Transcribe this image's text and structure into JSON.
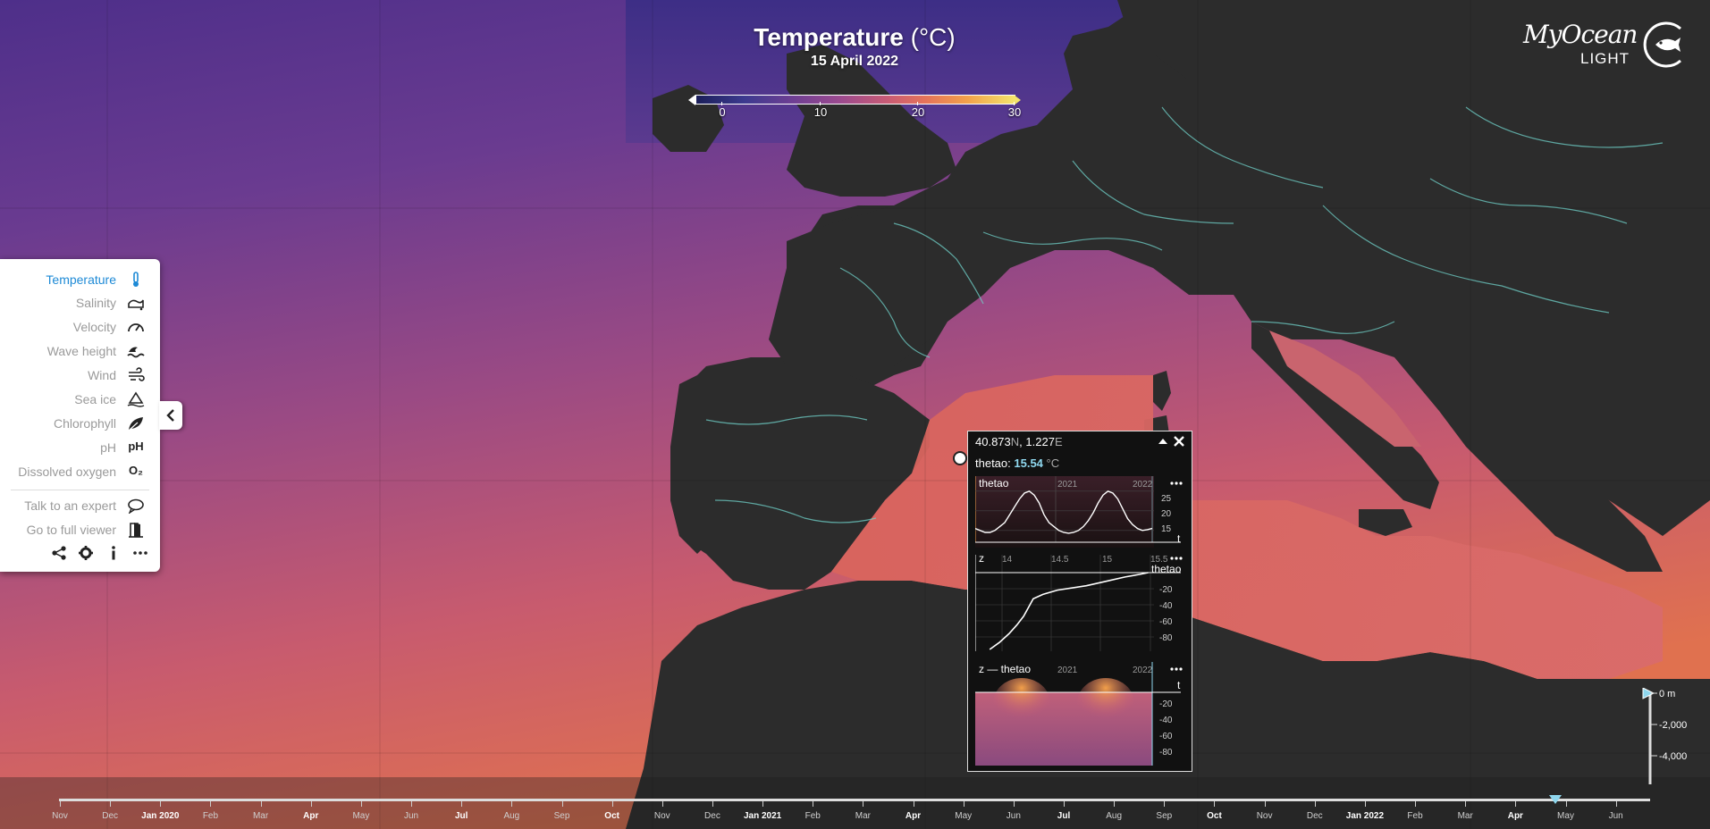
{
  "header": {
    "title": "Temperature",
    "unit": "(°C)",
    "date": "15 April 2022"
  },
  "colorbar": {
    "ticks": [
      "0",
      "10",
      "20",
      "30"
    ],
    "colors": [
      "#1b1f5a",
      "#6d3f93",
      "#c85b75",
      "#f2a04a",
      "#f3e46b"
    ]
  },
  "logo": {
    "name": "MyOcean",
    "sub": "LIGHT"
  },
  "sidebar": {
    "items": [
      {
        "label": "Temperature",
        "icon": "thermometer-icon",
        "active": true
      },
      {
        "label": "Salinity",
        "icon": "salinity-icon"
      },
      {
        "label": "Velocity",
        "icon": "speedometer-icon"
      },
      {
        "label": "Wave height",
        "icon": "wave-icon"
      },
      {
        "label": "Wind",
        "icon": "wind-icon"
      },
      {
        "label": "Sea ice",
        "icon": "sea-ice-icon"
      },
      {
        "label": "Chlorophyll",
        "icon": "leaf-icon"
      },
      {
        "label": "pH",
        "icon": "ph-icon",
        "icon_text": "pH"
      },
      {
        "label": "Dissolved oxygen",
        "icon": "oxygen-icon",
        "icon_text": "O₂"
      }
    ],
    "extra": [
      {
        "label": "Talk to an expert",
        "icon": "chat-icon"
      },
      {
        "label": "Go to full viewer",
        "icon": "door-icon"
      }
    ],
    "tools": [
      "share-icon",
      "gear-icon",
      "info-icon",
      "more-icon"
    ]
  },
  "popup": {
    "coords_lat": "40.873",
    "coords_lat_dir": "N",
    "coords_sep": ", ",
    "coords_lon": "1.227",
    "coords_lon_dir": "E",
    "var_label": "thetao: ",
    "var_value": "15.54",
    "var_unit": " °C",
    "panel1": {
      "label": "thetao",
      "years": [
        "2021",
        "2022"
      ],
      "yticks": [
        "25",
        "20",
        "15"
      ],
      "axis": "t",
      "series": [
        15.5,
        15,
        14.5,
        14.5,
        15,
        16,
        17,
        19,
        21,
        23,
        24.5,
        25,
        24,
        22,
        19,
        17,
        16,
        15,
        14.5,
        14.3,
        14.5,
        15,
        16,
        17.5,
        19.5,
        22,
        24,
        25,
        24.5,
        23,
        20.5,
        18,
        16.5,
        15.5,
        15,
        15.2,
        15.5
      ]
    },
    "panel2": {
      "label": "z",
      "var": "thetao",
      "xticks": [
        "14",
        "14.5",
        "15",
        "15.5"
      ],
      "yticks": [
        "-20",
        "-40",
        "-60",
        "-80"
      ],
      "profile": [
        [
          15.54,
          0
        ],
        [
          15.45,
          -2
        ],
        [
          15.3,
          -5
        ],
        [
          15.1,
          -10
        ],
        [
          14.9,
          -15
        ],
        [
          14.6,
          -20
        ],
        [
          14.45,
          -25
        ],
        [
          14.35,
          -30
        ],
        [
          14.3,
          -40
        ],
        [
          14.25,
          -50
        ],
        [
          14.18,
          -60
        ],
        [
          14.1,
          -70
        ],
        [
          14.0,
          -80
        ],
        [
          13.9,
          -88
        ]
      ]
    },
    "panel3": {
      "label": "z — thetao",
      "years": [
        "2021",
        "2022"
      ],
      "axis": "t",
      "yticks": [
        "-20",
        "-40",
        "-60",
        "-80"
      ]
    }
  },
  "depth": {
    "labels": [
      "0 m",
      "-2,000",
      "-4,000"
    ]
  },
  "timeline": {
    "labels": [
      {
        "text": "Nov",
        "strong": false
      },
      {
        "text": "Dec",
        "strong": false
      },
      {
        "text": "Jan 2020",
        "strong": true
      },
      {
        "text": "Feb",
        "strong": false
      },
      {
        "text": "Mar",
        "strong": false
      },
      {
        "text": "Apr",
        "strong": true
      },
      {
        "text": "May",
        "strong": false
      },
      {
        "text": "Jun",
        "strong": false
      },
      {
        "text": "Jul",
        "strong": true
      },
      {
        "text": "Aug",
        "strong": false
      },
      {
        "text": "Sep",
        "strong": false
      },
      {
        "text": "Oct",
        "strong": true
      },
      {
        "text": "Nov",
        "strong": false
      },
      {
        "text": "Dec",
        "strong": false
      },
      {
        "text": "Jan 2021",
        "strong": true
      },
      {
        "text": "Feb",
        "strong": false
      },
      {
        "text": "Mar",
        "strong": false
      },
      {
        "text": "Apr",
        "strong": true
      },
      {
        "text": "May",
        "strong": false
      },
      {
        "text": "Jun",
        "strong": false
      },
      {
        "text": "Jul",
        "strong": true
      },
      {
        "text": "Aug",
        "strong": false
      },
      {
        "text": "Sep",
        "strong": false
      },
      {
        "text": "Oct",
        "strong": true
      },
      {
        "text": "Nov",
        "strong": false
      },
      {
        "text": "Dec",
        "strong": false
      },
      {
        "text": "Jan 2022",
        "strong": true
      },
      {
        "text": "Feb",
        "strong": false
      },
      {
        "text": "Mar",
        "strong": false
      },
      {
        "text": "Apr",
        "strong": true
      },
      {
        "text": "May",
        "strong": false
      },
      {
        "text": "Jun",
        "strong": false
      }
    ],
    "current_date": "2022-04-15"
  },
  "colors": {
    "accent": "#1e8ad6",
    "value": "#8fd7ee",
    "land": "#2a2a2a",
    "rivers": "#6fd0c8"
  }
}
